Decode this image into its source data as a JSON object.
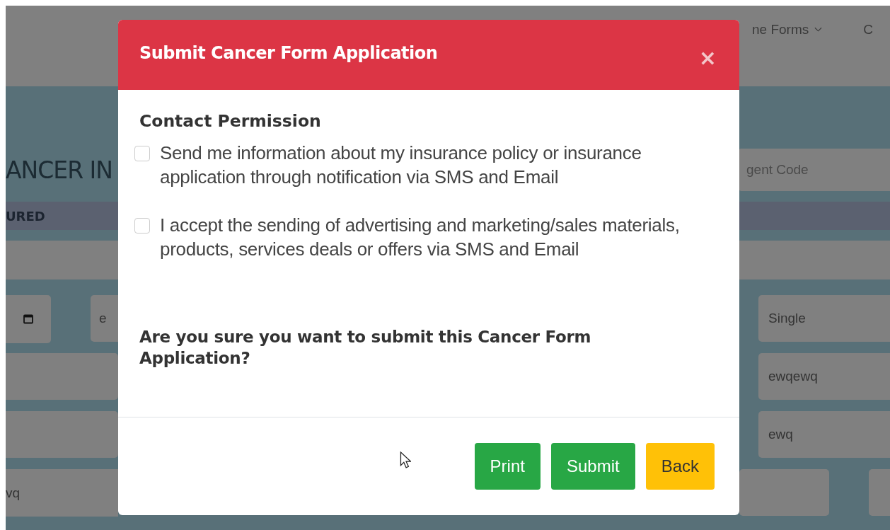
{
  "nav": {
    "items": [
      {
        "label": "ne Forms",
        "dropdown": true
      },
      {
        "label": "C",
        "dropdown": false
      }
    ]
  },
  "page": {
    "heading": "ANCER IN",
    "agent_code": {
      "placeholder": "gent Code"
    },
    "section_band": "URED",
    "rows": [
      {
        "left": [
          {
            "kind": "calendar"
          },
          {
            "kind": "field",
            "value": "e"
          }
        ],
        "right": [
          {
            "kind": "field",
            "value": "Single"
          }
        ]
      },
      {
        "left": [
          {
            "kind": "field"
          }
        ],
        "right": [
          {
            "kind": "field",
            "value": "ewqewq"
          }
        ]
      },
      {
        "left": [
          {
            "kind": "field"
          }
        ],
        "right": [
          {
            "kind": "field",
            "value": "ewq"
          }
        ]
      }
    ],
    "last_row": {
      "left_value": "vq"
    }
  },
  "modal": {
    "title": "Submit Cancer Form Application",
    "close": "×",
    "section_title": "Contact Permission",
    "permissions": [
      {
        "text": "Send me information about my insurance policy or insurance application through notification via SMS and Email",
        "checked": false
      },
      {
        "text": "I accept the sending of advertising and marketing/sales materials, products, services deals or offers via SMS and Email",
        "checked": false
      }
    ],
    "question": "Are you sure you want to submit this Cancer Form Application?",
    "buttons": [
      {
        "label": "Print",
        "kind": "success"
      },
      {
        "label": "Submit",
        "kind": "success"
      },
      {
        "label": "Back",
        "kind": "warning"
      }
    ]
  }
}
